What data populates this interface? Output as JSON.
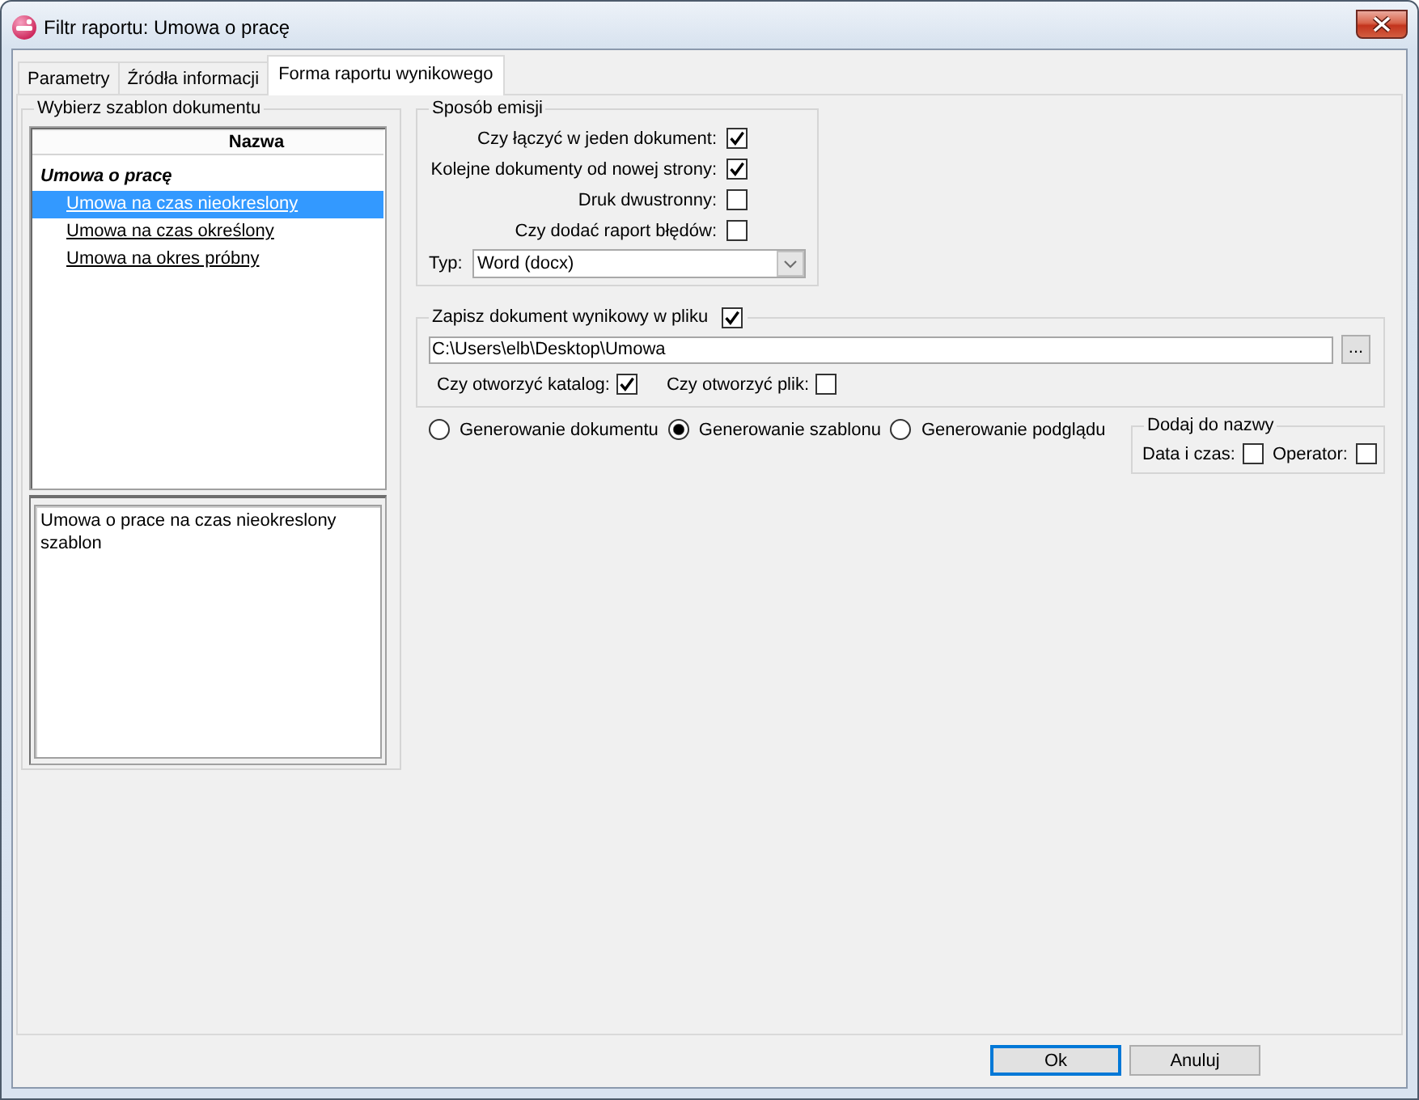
{
  "window": {
    "title": "Filtr raportu: Umowa o pracę"
  },
  "tabs": [
    {
      "label": "Parametry",
      "selected": false
    },
    {
      "label": "Źródła informacji",
      "selected": false
    },
    {
      "label": "Forma raportu wynikowego",
      "selected": true
    }
  ],
  "template_picker": {
    "title": "Wybierz szablon dokumentu",
    "column": "Nazwa",
    "items": [
      {
        "label": "Umowa o pracę",
        "selected": false,
        "children": [
          {
            "label": "Umowa na czas nieokreslony",
            "selected": true
          },
          {
            "label": "Umowa na czas określony",
            "selected": false
          },
          {
            "label": "Umowa na okres próbny",
            "selected": false
          }
        ]
      }
    ],
    "description": "Umowa o prace na czas nieokreslony szablon"
  },
  "emission": {
    "title": "Sposób emisji",
    "options": [
      {
        "label": "Czy łączyć w jeden dokument:",
        "checked": true
      },
      {
        "label": "Kolejne dokumenty od nowej strony:",
        "checked": true
      },
      {
        "label": "Druk dwustronny:",
        "checked": false
      },
      {
        "label": "Czy dodać raport błędów:",
        "checked": false
      }
    ],
    "type": {
      "label": "Typ:",
      "value": "Word (docx)"
    }
  },
  "save_to_file": {
    "label": "Zapisz dokument wynikowy w pliku",
    "checked": true,
    "path": "C:\\Users\\elb\\Desktop\\Umowa",
    "browse": "...",
    "options": [
      {
        "label": "Czy otworzyć katalog:",
        "checked": true
      },
      {
        "label": "Czy otworzyć plik:",
        "checked": false
      }
    ]
  },
  "generation_mode": [
    {
      "label": "Generowanie dokumentu",
      "selected": false
    },
    {
      "label": "Generowanie szablonu",
      "selected": true
    },
    {
      "label": "Generowanie podglądu",
      "selected": false
    }
  ],
  "add_to_name": {
    "title": "Dodaj do nazwy",
    "options": [
      {
        "label": "Data i czas:",
        "checked": false
      },
      {
        "label": "Operator:",
        "checked": false
      }
    ]
  },
  "buttons": [
    {
      "label": "Ok",
      "default": true
    },
    {
      "label": "Anuluj",
      "default": false
    }
  ]
}
